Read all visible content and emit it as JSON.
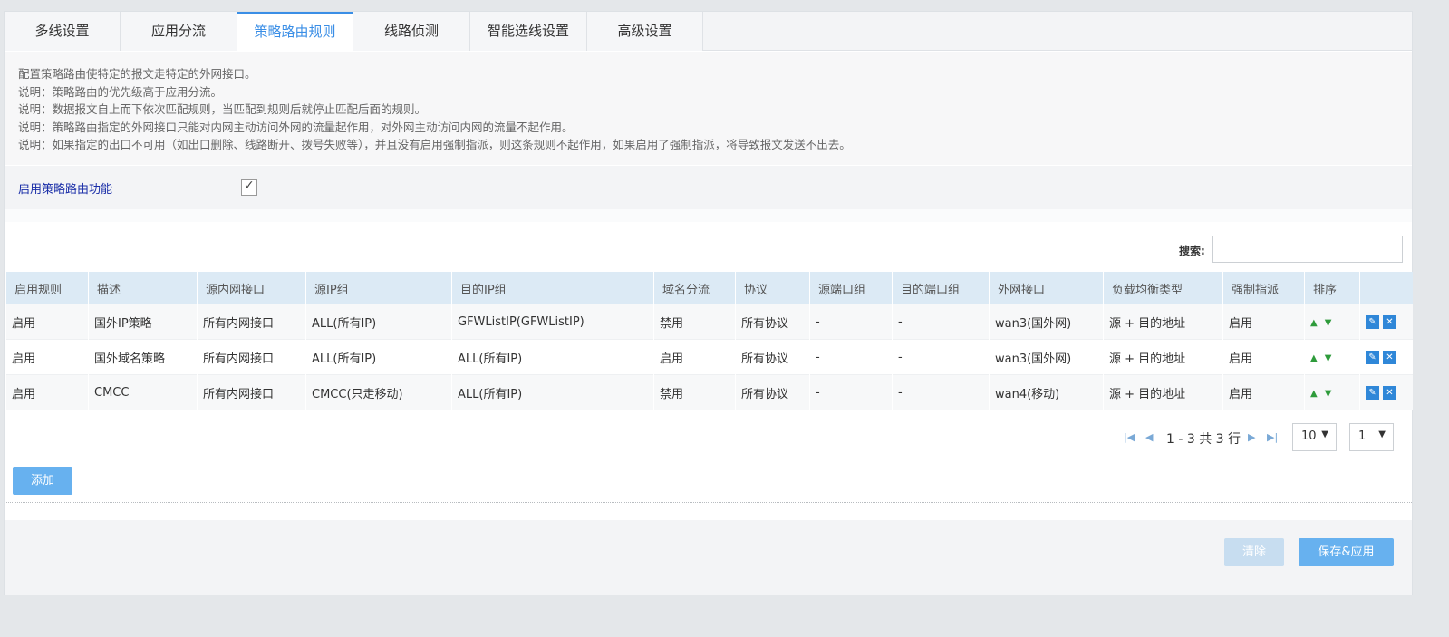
{
  "tabs": [
    {
      "label": "多线设置"
    },
    {
      "label": "应用分流"
    },
    {
      "label": "策略路由规则"
    },
    {
      "label": "线路侦测"
    },
    {
      "label": "智能选线设置"
    },
    {
      "label": "高级设置"
    }
  ],
  "active_tab": "策略路由规则",
  "description": [
    "配置策略路由使特定的报文走特定的外网接口。",
    "说明：策略路由的优先级高于应用分流。",
    "说明：数据报文自上而下依次匹配规则，当匹配到规则后就停止匹配后面的规则。",
    "说明：策略路由指定的外网接口只能对内网主动访问外网的流量起作用，对外网主动访问内网的流量不起作用。",
    "说明：如果指定的出口不可用（如出口删除、线路断开、拨号失败等），并且没有启用强制指派，则这条规则不起作用，如果启用了强制指派，将导致报文发送不出去。"
  ],
  "enable": {
    "label": "启用策略路由功能",
    "checked": true,
    "check_glyph": "✓"
  },
  "search": {
    "label": "搜索:",
    "value": "",
    "placeholder": ""
  },
  "table": {
    "headers": [
      "启用规则",
      "描述",
      "源内网接口",
      "源IP组",
      "目的IP组",
      "域名分流",
      "协议",
      "源端口组",
      "目的端口组",
      "外网接口",
      "负载均衡类型",
      "强制指派",
      "排序",
      ""
    ],
    "rows": [
      [
        "启用",
        "国外IP策略",
        "所有内网接口",
        "ALL(所有IP)",
        "GFWListIP(GFWListIP)",
        "禁用",
        "所有协议",
        "-",
        "-",
        "wan3(国外网)",
        "源 + 目的地址",
        "启用"
      ],
      [
        "启用",
        "国外域名策略",
        "所有内网接口",
        "ALL(所有IP)",
        "ALL(所有IP)",
        "启用",
        "所有协议",
        "-",
        "-",
        "wan3(国外网)",
        "源 + 目的地址",
        "启用"
      ],
      [
        "启用",
        "CMCC",
        "所有内网接口",
        "CMCC(只走移动)",
        "ALL(所有IP)",
        "禁用",
        "所有协议",
        "-",
        "-",
        "wan4(移动)",
        "源 + 目的地址",
        "启用"
      ]
    ]
  },
  "pagination": {
    "text": "1 - 3 共 3 行",
    "page_size": "10",
    "page": "1"
  },
  "buttons": {
    "add": "添加",
    "clear": "清除",
    "save": "保存&应用"
  },
  "colors": {
    "accent": "#3a8ee6",
    "button": "#67b1ef",
    "header_bg": "#dceaf5",
    "icon_button": "#2f87d8"
  },
  "icons": {
    "up": "arrow-up-icon",
    "down": "arrow-down-icon",
    "edit": "edit-icon",
    "delete": "delete-icon"
  }
}
